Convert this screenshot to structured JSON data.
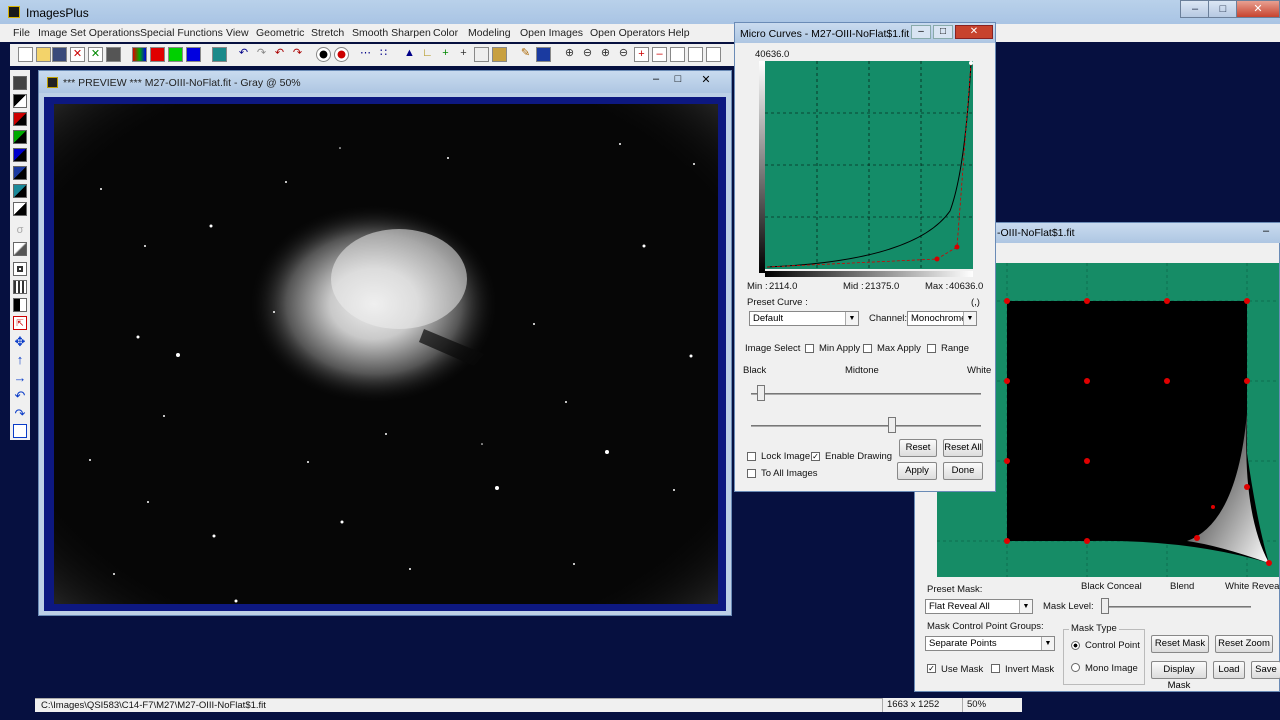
{
  "app": {
    "title": "ImagesPlus"
  },
  "menu": [
    "File",
    "Image Set Operations",
    "Special Functions",
    "View",
    "Geometric",
    "Stretch",
    "Smooth Sharpen",
    "Color",
    "Modeling",
    "Open Images",
    "Open Operators",
    "Help"
  ],
  "preview": {
    "title": "*** PREVIEW *** M27-OIII-NoFlat.fit - Gray @ 50%"
  },
  "curves": {
    "title": "Micro Curves - M27-OIII-NoFlat$1.fit",
    "top_value": "40636.0",
    "min_label": "Min :",
    "min_value": "2114.0",
    "mid_label": "Mid :",
    "mid_value": "21375.0",
    "max_label": "Max :",
    "max_value": "40636.0",
    "preset_label": "Preset Curve :",
    "preset_value": "Default",
    "paren": "(,)",
    "channel_label": "Channel:",
    "channel_value": "Monochrome",
    "image_select": "Image Select",
    "min_apply": "Min Apply",
    "max_apply": "Max Apply",
    "range": "Range",
    "black": "Black",
    "midtone": "Midtone",
    "white": "White",
    "lock_image": "Lock Image",
    "enable_drawing": "Enable Drawing",
    "to_all_images": "To All Images",
    "reset": "Reset",
    "reset_all": "Reset All",
    "apply": "Apply",
    "done": "Done",
    "grid_color": "#148c68"
  },
  "mask": {
    "title": "-OIII-NoFlat$1.fit",
    "black_conceal": "Black Conceal",
    "blend": "Blend",
    "white_reveal": "White Reveal",
    "preset_mask_label": "Preset Mask:",
    "preset_mask_value": "Flat Reveal All",
    "mask_level": "Mask Level:",
    "groups_label": "Mask Control Point Groups:",
    "groups_value": "Separate Points",
    "mask_type": "Mask Type",
    "control_point": "Control Point",
    "mono_image": "Mono Image",
    "reset_mask": "Reset Mask",
    "reset_zoom": "Reset Zoom",
    "use_mask": "Use Mask",
    "invert_mask": "Invert Mask",
    "display_mask": "Display Mask",
    "load": "Load",
    "save": "Save"
  },
  "status": {
    "path": "C:\\Images\\QSI583\\C14-F7\\M27\\M27-OIII-NoFlat$1.fit",
    "dims": "1663 x 1252",
    "zoom": "50%"
  }
}
